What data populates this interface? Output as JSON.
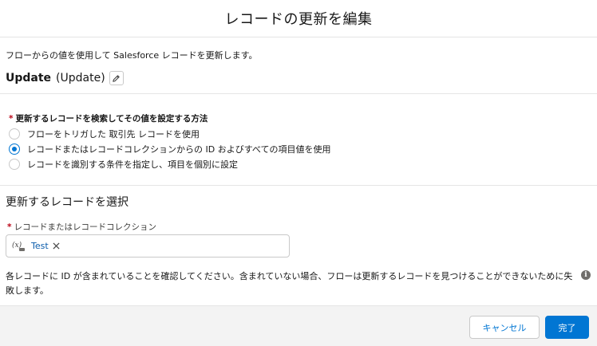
{
  "modal": {
    "title": "レコードの更新を編集",
    "description": "フローからの値を使用して Salesforce レコードを更新します。"
  },
  "element": {
    "label": "Update",
    "api_name": "(Update)",
    "edit_icon": "pencil-icon"
  },
  "method": {
    "required_marker": "*",
    "label": "更新するレコードを検索してその値を設定する方法",
    "options": [
      {
        "label": "フローをトリガした 取引先 レコードを使用",
        "checked": false
      },
      {
        "label": "レコードまたはレコードコレクションからの ID およびすべての項目値を使用",
        "checked": true
      },
      {
        "label": "レコードを識別する条件を指定し、項目を個別に設定",
        "checked": false
      }
    ]
  },
  "select_record": {
    "section_title": "更新するレコードを選択",
    "required_marker": "*",
    "field_label": "レコードまたはレコードコレクション",
    "pill": {
      "icon": "variable-icon",
      "label": "Test",
      "remove_icon": "close-icon"
    },
    "note": "各レコードに ID が含まれていることを確認してください。含まれていない場合、フローは更新するレコードを見つけることができないために失敗します。",
    "info_icon": "info-icon"
  },
  "footer": {
    "cancel_label": "キャンセル",
    "done_label": "完了"
  },
  "colors": {
    "brand": "#0176d3",
    "required": "#ba0517",
    "footer_bg": "#f3f3f3"
  }
}
